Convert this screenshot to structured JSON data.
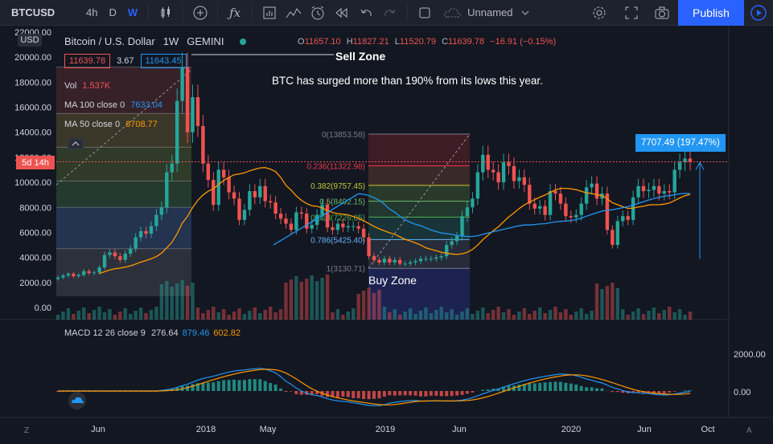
{
  "toolbar": {
    "symbol": "BTCUSD",
    "intervals": [
      "4h",
      "D",
      "W"
    ],
    "active_interval": "W",
    "layout_name": "Unnamed",
    "publish_label": "Publish"
  },
  "legend": {
    "title": "Bitcoin / U.S. Dollar",
    "interval": "1W",
    "exchange": "GEMINI",
    "open_label": "O",
    "open": "11657.10",
    "high_label": "H",
    "high": "11827.21",
    "low_label": "L",
    "low": "11520.79",
    "close_label": "C",
    "close": "11639.78",
    "change": "−16.91 (−0.15%)",
    "bid": "11639.78",
    "spread": "3.67",
    "ask": "11643.45",
    "vol_label": "Vol",
    "vol_value": "1.537K",
    "ma100_label": "MA 100 close 0",
    "ma100_value": "7633.04",
    "ma50_label": "MA 50 close 0",
    "ma50_value": "8708.77",
    "macd_label": "MACD 12 26 close 9",
    "macd_hist": "276.64",
    "macd_line": "879.46",
    "macd_signal": "602.82"
  },
  "annotations": {
    "sell_zone": "Sell Zone",
    "buy_zone": "Buy Zone",
    "note": "BTC has surged more than 190% from its lows this year.",
    "measure": "7707.49 (197.47%)",
    "price_tag_time": "5d 14h",
    "usd": "USD"
  },
  "fib_levels": [
    {
      "label": "0(13853.58)",
      "price": 13853.58,
      "color": "#787b86"
    },
    {
      "label": "0.236(11322.98)",
      "price": 11322.98,
      "color": "#f23645"
    },
    {
      "label": "0.382(9757.45)",
      "price": 9757.45,
      "color": "#c0ca33"
    },
    {
      "label": "0.5(8492.15)",
      "price": 8492.15,
      "color": "#66bb6a"
    },
    {
      "label": "0.618(7226.85)",
      "price": 7226.85,
      "color": "#4caf50"
    },
    {
      "label": "0.786(5425.40)",
      "price": 5425.4,
      "color": "#64b5f6"
    },
    {
      "label": "1(3130.71)",
      "price": 3130.71,
      "color": "#787b86"
    }
  ],
  "colors": {
    "up": "#26a69a",
    "down": "#ef5350",
    "ma100": "#2196f3",
    "ma50": "#ff9800",
    "accent": "#2962ff"
  },
  "price_axis": {
    "ticks": [
      "22000.00",
      "20000.00",
      "18000.00",
      "16000.00",
      "14000.00",
      "12000.00",
      "10000.00",
      "8000.00",
      "6000.00",
      "4000.00",
      "2000.00",
      "0.00"
    ],
    "values": [
      22000,
      20000,
      18000,
      16000,
      14000,
      12000,
      10000,
      8000,
      6000,
      4000,
      2000,
      0
    ]
  },
  "macd_axis": {
    "ticks": [
      "2000.00",
      "0.00"
    ]
  },
  "time_axis": {
    "labels": [
      "Jun",
      "2018",
      "May",
      "2019",
      "Jun",
      "2020",
      "Jun",
      "Oct"
    ]
  },
  "chart_data": {
    "type": "candlestick",
    "title": "Bitcoin / U.S. Dollar",
    "ylim": [
      0,
      22000
    ],
    "weekly_close": [
      2400,
      2550,
      2700,
      2500,
      2600,
      2900,
      2750,
      2800,
      3200,
      4200,
      4400,
      4100,
      3800,
      4300,
      4700,
      5600,
      6100,
      5900,
      6500,
      7400,
      8000,
      10800,
      11500,
      16500,
      19200,
      14000,
      16800,
      14500,
      11500,
      10200,
      8200,
      11000,
      10400,
      9200,
      8700,
      7000,
      7800,
      9300,
      8800,
      9700,
      8500,
      8400,
      7500,
      7100,
      6700,
      6200,
      7600,
      7500,
      6300,
      6600,
      7400,
      8200,
      6400,
      6200,
      6700,
      6400,
      6500,
      6500,
      6300,
      5600,
      4100,
      3800,
      3600,
      3900,
      3600,
      3800,
      3500,
      3500,
      3600,
      3700,
      3900,
      3900,
      3900,
      4000,
      4100,
      5000,
      5300,
      5700,
      7300,
      8000,
      8700,
      10800,
      12200,
      11000,
      10800,
      10000,
      11600,
      11300,
      10100,
      10400,
      9800,
      8300,
      7900,
      8100,
      7400,
      9300,
      9100,
      8300,
      7300,
      7200,
      7400,
      8300,
      9600,
      9900,
      8700,
      9100,
      6200,
      5000,
      6900,
      7300,
      7000,
      8800,
      9700,
      9300,
      9400,
      9700,
      9100,
      9300,
      9200,
      11000,
      11600,
      11900,
      11640
    ],
    "ma100": [
      null
    ],
    "ma50": [
      null
    ]
  }
}
